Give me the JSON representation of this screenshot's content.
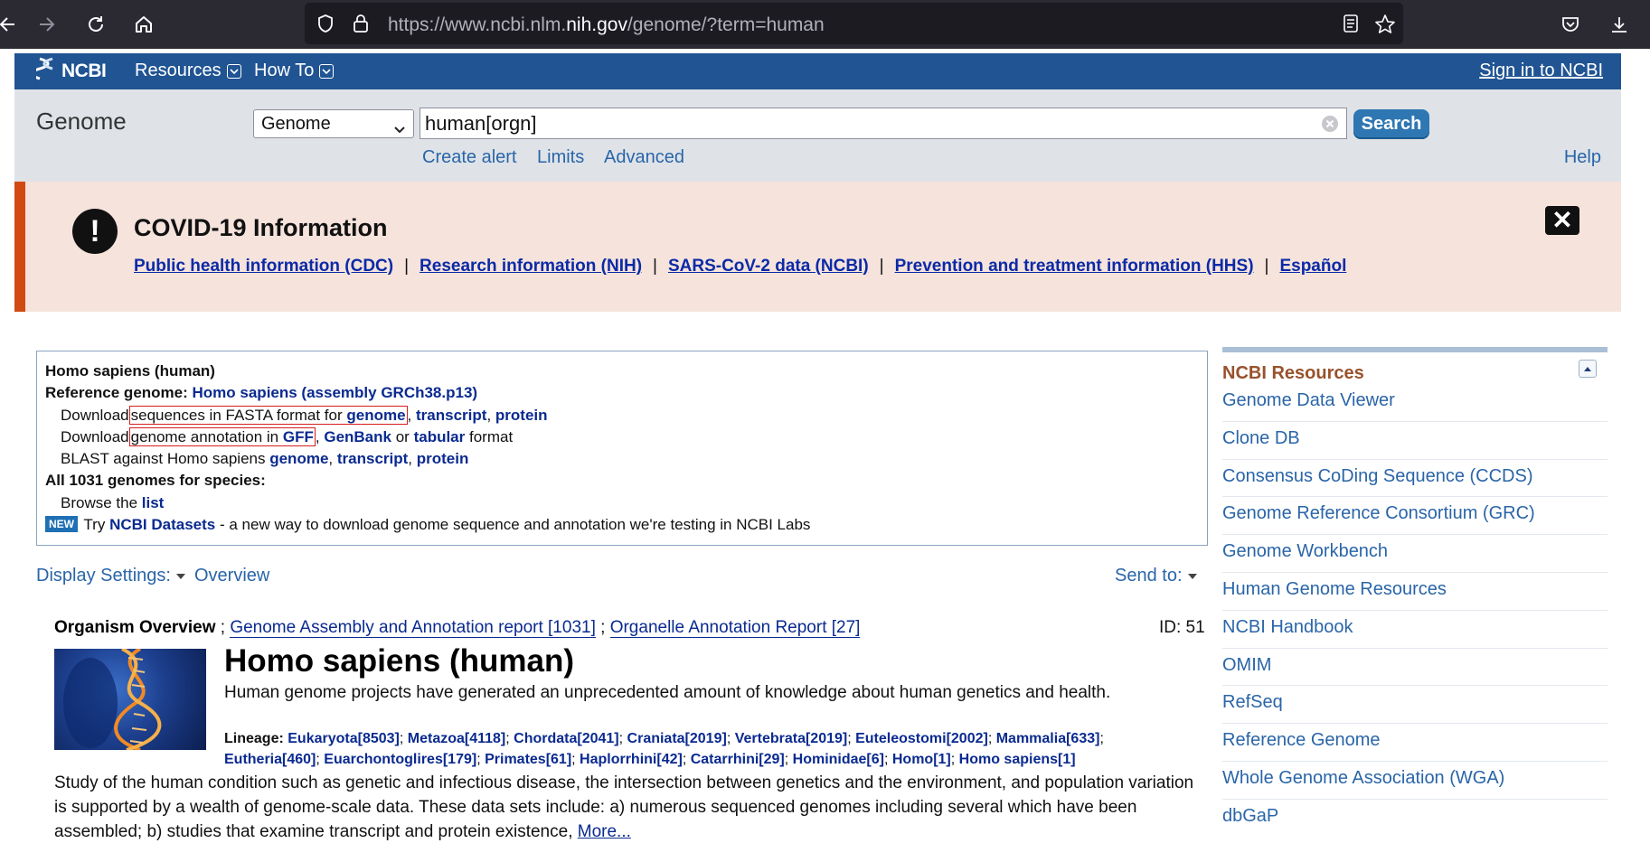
{
  "browser": {
    "url_prefix": "https://www.ncbi.nlm.",
    "url_domain": "nih.gov",
    "url_suffix": "/genome/?term=human"
  },
  "header": {
    "logo": "NCBI",
    "resources": "Resources",
    "howto": "How To",
    "signin": "Sign in to NCBI"
  },
  "search": {
    "db_title": "Genome",
    "db_select": "Genome",
    "query": "human[orgn]",
    "button": "Search",
    "create_alert": "Create alert",
    "limits": "Limits",
    "advanced": "Advanced",
    "help": "Help"
  },
  "covid": {
    "title": "COVID-19 Information",
    "links": [
      "Public health information (CDC)",
      "Research information (NIH)",
      "SARS-CoV-2 data (NCBI)",
      "Prevention and treatment information (HHS)",
      "Español"
    ],
    "sep": "|"
  },
  "refbox": {
    "organism": "Homo sapiens (human)",
    "ref_label": "Reference genome:",
    "ref_link": "Homo sapiens (assembly GRCh38.p13)",
    "dl1_prefix": "Download",
    "dl1_box": "sequences in FASTA format for",
    "dl1_genome": "genome",
    "comma": ",",
    "dl1_transcript": "transcript",
    "dl1_protein": "protein",
    "dl2_prefix": "Download",
    "dl2_box": "genome annotation in",
    "dl2_gff": "GFF",
    "dl2_genbank": "GenBank",
    "dl2_or": "or",
    "dl2_tabular": "tabular",
    "dl2_format": "format",
    "blast_prefix": "BLAST against Homo sapiens",
    "blast_genome": "genome",
    "blast_transcript": "transcript",
    "blast_protein": "protein",
    "all_genomes": "All 1031 genomes for species:",
    "browse_prefix": "Browse the",
    "browse_link": "list",
    "new_badge": "NEW",
    "try": "Try",
    "datasets": "NCBI Datasets",
    "datasets_desc": "- a new way to download genome sequence and annotation we're testing in NCBI Labs"
  },
  "display": {
    "settings": "Display Settings:",
    "overview": "Overview",
    "sendto": "Send to:"
  },
  "overview": {
    "label": "Organism Overview",
    "sep": ";",
    "assembly_link": "Genome Assembly and Annotation report",
    "assembly_count": "[1031]",
    "organelle_link": "Organelle Annotation Report",
    "organelle_count": "[27]",
    "id": "ID: 51",
    "title": "Homo sapiens (human)",
    "desc": "Human genome projects have generated an unprecedented amount of knowledge about human genetics and health.",
    "lineage_label": "Lineage:",
    "lineage": [
      "Eukaryota[8503]",
      "Metazoa[4118]",
      "Chordata[2041]",
      "Craniata[2019]",
      "Vertebrata[2019]",
      "Euteleostomi[2002]",
      "Mammalia[633]",
      "Eutheria[460]",
      "Euarchontoglires[179]",
      "Primates[61]",
      "Haplorrhini[42]",
      "Catarrhini[29]",
      "Hominidae[6]",
      "Homo[1]",
      "Homo sapiens[1]"
    ],
    "study": "Study of the human condition such as genetic and infectious disease, the intersection between genetics and the environment, and population variation is supported by a wealth of genome-scale data. These data sets include: a) numerous sequenced genomes including several which have been assembled; b) studies that examine transcript and protein existence,",
    "more": "More..."
  },
  "sidebar": {
    "title": "NCBI Resources",
    "items": [
      "Genome Data Viewer",
      "Clone DB",
      "Consensus CoDing Sequence (CCDS)",
      "Genome Reference Consortium (GRC)",
      "Genome Workbench",
      "Human Genome Resources",
      "NCBI Handbook",
      "OMIM",
      "RefSeq",
      "Reference Genome",
      "Whole Genome Association (WGA)",
      "dbGaP"
    ]
  },
  "colors": {
    "ncbi_blue": "#205493",
    "covid_bg": "#f5e3dc",
    "covid_accent": "#d04a12",
    "link": "#0a2a90",
    "sidebar_title": "#98522c"
  }
}
